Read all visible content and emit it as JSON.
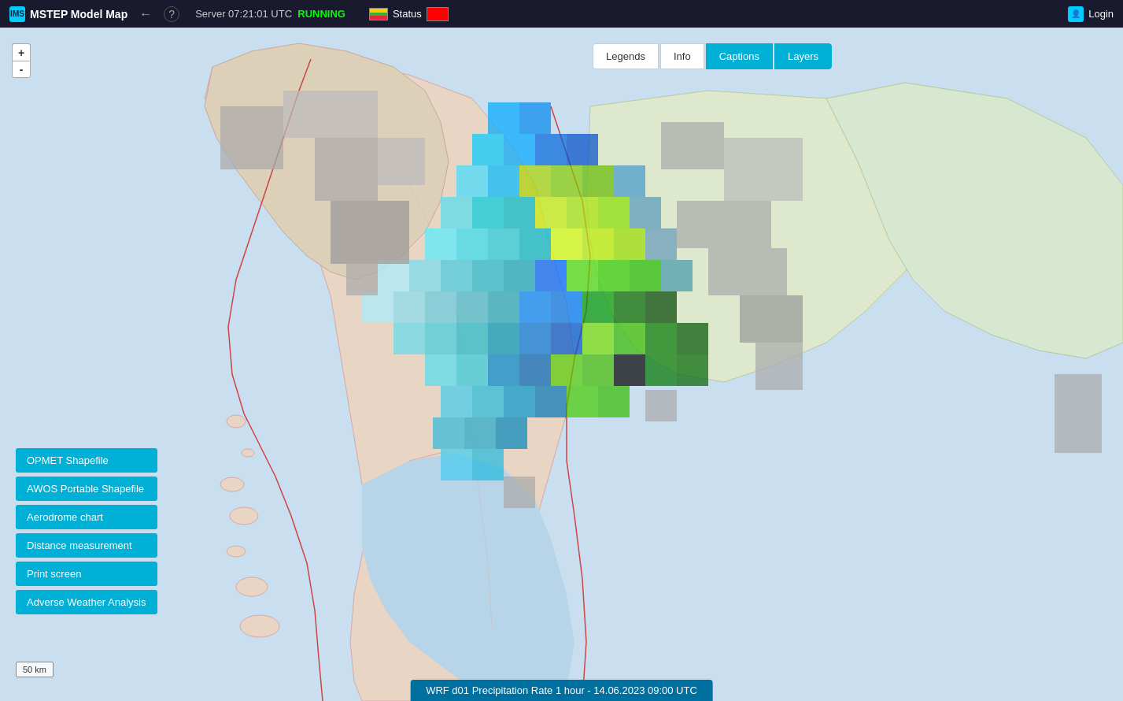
{
  "header": {
    "logo": "IMS",
    "title": "MSTEP  Model Map",
    "back_arrow": "←",
    "help": "?",
    "server_label": "Server 07:21:01 UTC",
    "server_status": "RUNNING",
    "status_label": "Status",
    "login_label": "Login"
  },
  "toolbar": {
    "legends_label": "Legends",
    "info_label": "Info",
    "captions_label": "Captions",
    "layers_label": "Layers"
  },
  "zoom": {
    "in_label": "+",
    "out_label": "-"
  },
  "side_buttons": {
    "opmet": "OPMET Shapefile",
    "awos": "AWOS Portable Shapefile",
    "aerodrome": "Aerodrome chart",
    "distance": "Distance measurement",
    "print": "Print screen",
    "adverse": "Adverse Weather Analysis"
  },
  "scale_bar": {
    "label": "50 km"
  },
  "bottom_bar": {
    "text": "WRF d01 Precipitation Rate 1 hour - 14.06.2023 09:00 UTC"
  },
  "colors": {
    "header_bg": "#1a1a2e",
    "active_btn": "#00b0d6",
    "bottom_bar_bg": "#0070a0"
  }
}
